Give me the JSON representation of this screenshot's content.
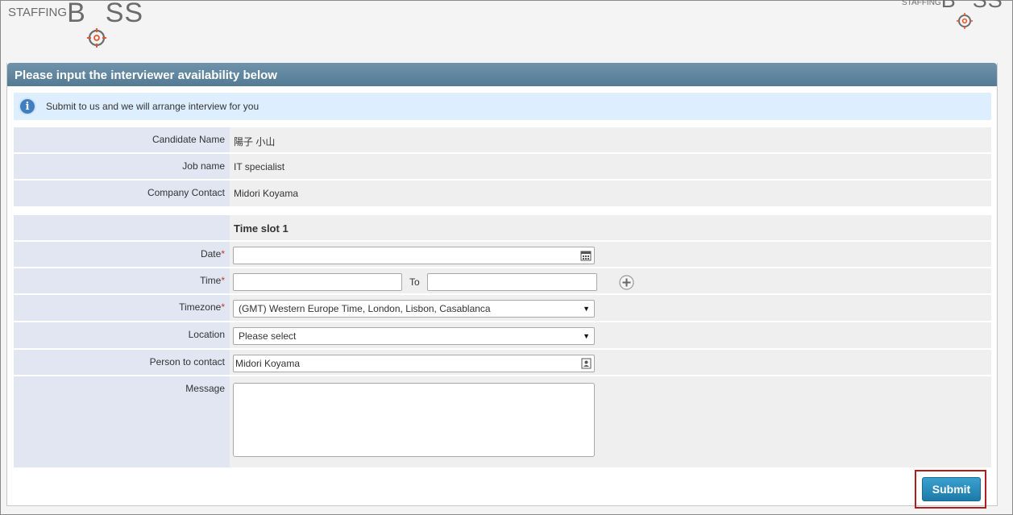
{
  "brand": {
    "small": "STAFFING",
    "big_before": "B",
    "big_o": "O",
    "big_after": "SS",
    "colors": {
      "gray": "#6b6b6b",
      "accent": "#e4572e"
    }
  },
  "panel": {
    "title": "Please input the interviewer availability below",
    "info": "Submit to us and we will arrange interview for you"
  },
  "details": [
    {
      "label": "Candidate Name",
      "value": "陽子 小山"
    },
    {
      "label": "Job name",
      "value": "IT specialist"
    },
    {
      "label": "Company Contact",
      "value": "Midori Koyama"
    }
  ],
  "slot": {
    "heading": "Time slot 1",
    "date_label": "Date",
    "time_label": "Time",
    "to_label": "To",
    "timezone_label": "Timezone",
    "timezone_value": "(GMT) Western Europe Time, London, Lisbon, Casablanca",
    "location_label": "Location",
    "location_value": "Please select",
    "person_label": "Person to contact",
    "person_value": "Midori Koyama",
    "message_label": "Message",
    "required_mark": "*"
  },
  "submit_label": "Submit",
  "colors": {
    "header": "#5f86a0",
    "info_bg": "#ddeeff",
    "label_bg": "#e1e6f2",
    "submit": "#2a8bbd",
    "highlight": "#b11d1d"
  }
}
